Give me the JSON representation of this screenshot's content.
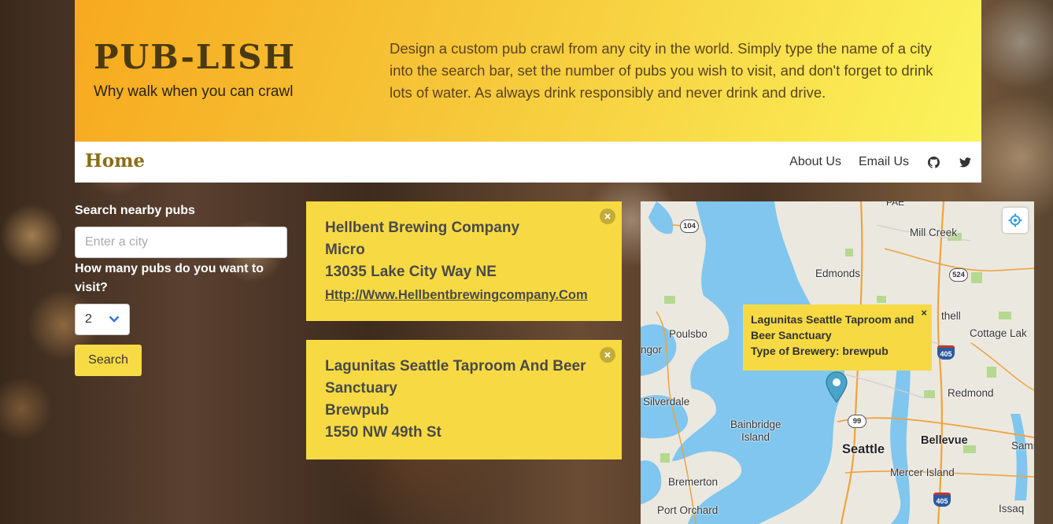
{
  "header": {
    "brand": "PUB-LISH",
    "tagline": "Why walk when you can crawl",
    "intro": "Design a custom pub crawl from any city in the world. Simply type the name of a city into the search bar, set the number of pubs you wish to visit, and don't forget to drink lots of water. As always drink responsibly and never drink and drive."
  },
  "nav": {
    "home": "Home",
    "about": "About Us",
    "email": "Email Us",
    "icons": [
      "github-icon",
      "twitter-icon"
    ]
  },
  "search": {
    "label": "Search nearby pubs",
    "placeholder": "Enter a city",
    "count_label": "How many pubs do you want to visit?",
    "count_value": "2",
    "button": "Search"
  },
  "results": [
    {
      "name": "Hellbent Brewing Company",
      "type": "Micro",
      "address": "13035 Lake City Way NE",
      "url": "Http://Www.Hellbentbrewingcompany.Com"
    },
    {
      "name": "Lagunitas Seattle Taproom And Beer Sanctuary",
      "type": "Brewpub",
      "address": "1550 NW 49th St"
    }
  ],
  "map": {
    "popup_name": "Lagunitas Seattle Taproom and Beer Sanctuary",
    "popup_type": "Type of Brewery: brewpub",
    "popup_close": "×",
    "labels": {
      "pae": "PAE",
      "mill_creek": "Mill Creek",
      "edmonds": "Edmonds",
      "thell": "thell",
      "poulsbo": "Poulsbo",
      "ngor": "ngor",
      "cottage_lake": "Cottage Lak",
      "redmond": "Redmond",
      "silverdale": "Silverdale",
      "bainbridge": "Bainbridge",
      "island": "Island",
      "seattle": "Seattle",
      "bellevue": "Bellevue",
      "samma": "Samma",
      "mercer": "Mercer Island",
      "bremerton": "Bremerton",
      "issaq": "Issaq",
      "port_orchard": "Port Orchard"
    },
    "shields": {
      "r104": "104",
      "r524": "524",
      "r99": "99",
      "i405a": "405",
      "i405b": "405"
    }
  },
  "colors": {
    "header_start": "#f7a91f",
    "header_end": "#fbf45c",
    "card": "#f7da43",
    "water": "#80c6ee"
  }
}
